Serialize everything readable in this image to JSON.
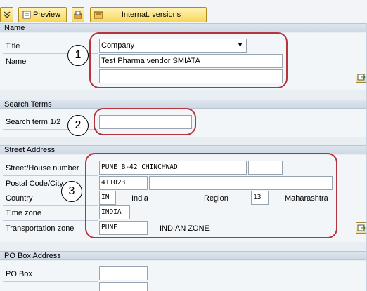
{
  "toolbar": {
    "preview_label": "Preview",
    "internat_label": "Internat. versions",
    "icons": [
      "expand-icon",
      "preview-icon",
      "print-icon",
      "internat-versions-icon"
    ]
  },
  "sections": {
    "name": "Name",
    "search_terms": "Search Terms",
    "street_address": "Street Address",
    "po_box_address": "PO Box Address"
  },
  "name_section": {
    "title_label": "Title",
    "title_value": "Company",
    "name_label": "Name",
    "name_value": "Test Pharma vendor SMIATA",
    "name2_value": ""
  },
  "search_section": {
    "search_term_label": "Search term 1/2",
    "search_term_value": ""
  },
  "street_section": {
    "street_label": "Street/House number",
    "street_value": "PUNE B-42 CHINCHWAD",
    "house_value": "",
    "postal_label": "Postal Code/City",
    "postal_value": "411023",
    "city_value": "",
    "country_label": "Country",
    "country_code": "IN",
    "country_name": "India",
    "region_label": "Region",
    "region_code": "13",
    "region_name": "Maharashtra",
    "timezone_label": "Time zone",
    "timezone_value": "INDIA",
    "transport_label": "Transportation zone",
    "transport_value": "PUNE",
    "transport_desc": "INDIAN ZONE"
  },
  "po_section": {
    "po_box_label": "PO Box",
    "po_box_value": ""
  },
  "annotations": [
    "1",
    "2",
    "3"
  ],
  "colors": {
    "highlight": "#b5343e",
    "button_gold": "#f7d85c",
    "section_header": "#cfd9e4"
  }
}
